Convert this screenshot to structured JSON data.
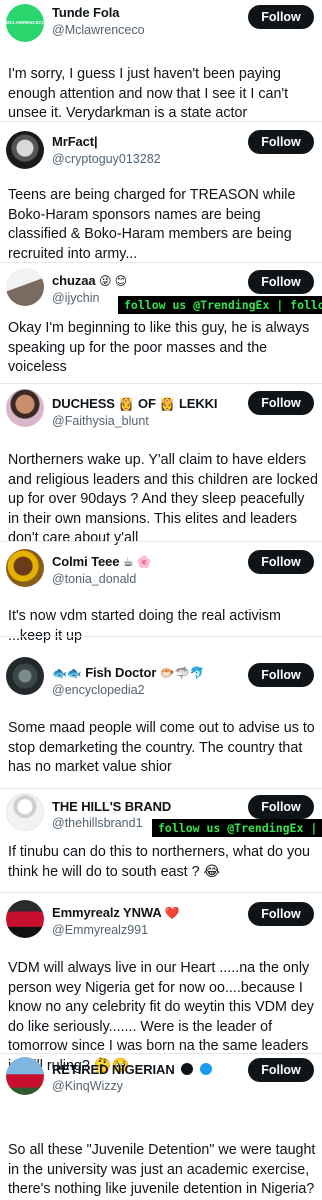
{
  "follow_label": "Follow",
  "banner_text": "follow us @TrendingEx | follow us @TrendingEx | follow us",
  "posts": [
    {
      "name": "Tunde Fola",
      "handle": "@Mclawrenceco",
      "avatar_text": "MCLAWRENCECO",
      "text": "I'm sorry, I guess I just haven't been paying enough attention and now that I see it I can't unsee it. Verydarkman is a state actor"
    },
    {
      "name": "MrFact|",
      "handle": "@cryptoguy013282",
      "text": "Teens are being charged for TREASON while Boko-Haram sponsors names are being classified & Boko-Haram members are being recruited into army..."
    },
    {
      "name": "chuzaa",
      "name_emoji": "😜 😊",
      "handle": "@ijychin",
      "text": "Okay I'm beginning to like this guy, he is always speaking up for the poor masses and the voiceless"
    },
    {
      "name": "DUCHESS 👸 OF 👸 LEKKI",
      "handle": "@Faithysia_blunt",
      "text": "Northerners wake up. Y'all claim to have elders and religious leaders and this children are locked up for over 90days ? And they sleep peacefully in their own mansions. This elites and leaders don't care about y'all"
    },
    {
      "name": "Colmi Teee",
      "name_emoji": "☕ 🌸",
      "handle": "@tonia_donald",
      "text": "It's now vdm started doing the real activism ...keep it up"
    },
    {
      "name": "Fish Doctor",
      "name_prefix": "🐟🐟",
      "name_emoji": "🐡🦈🐬",
      "handle": "@encyclopedia2",
      "text": "Some maad people will come out to advise us to stop demarketing the country. The country that has no market value shior"
    },
    {
      "name": "THE HILL'S BRAND",
      "handle": "@thehillsbrand1",
      "text": "If tinubu can do this to northerners, what do you think he will do to south east ? 😂"
    },
    {
      "name": "Emmyrealz YNWA",
      "name_emoji": "❤️",
      "handle": "@Emmyrealz991",
      "text": "VDM will always live in our Heart .....na the only person wey Nigeria get for now oo....because I know no any celebrity fit do weytin this VDM dey do like seriously....... Were is the leader of tomorrow since I was born na the same leaders is still ruling? 🤔🥺"
    },
    {
      "name": "RETIRED NIGERIAN",
      "handle": "@KinqWizzy",
      "text": "So all these \"Juvenile Detention\" we were taught in the university was just an academic exercise, there's nothing like juvenile detention in Nigeria?"
    }
  ],
  "colors": {
    "background": "#ffffff",
    "text": "#0f1419",
    "secondary": "#536471",
    "button": "#0f1419",
    "banner_text": "#36e34f",
    "verified_gold": "#e2b719",
    "verified_blue": "#1d9bf0"
  }
}
